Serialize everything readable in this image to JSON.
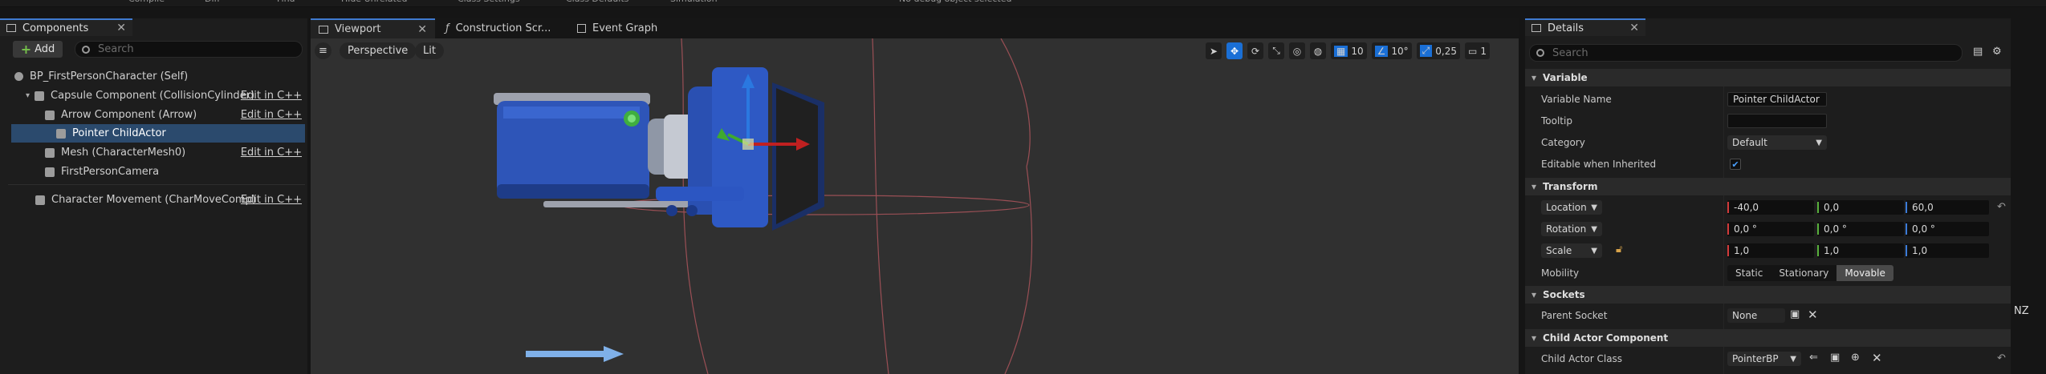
{
  "toolbar": {
    "items": [
      "Compile",
      "Diff",
      "Find",
      "Hide Unrelated",
      "Class Settings",
      "Class Defaults",
      "Simulation",
      "No debug object selected"
    ]
  },
  "components_panel": {
    "tab_title": "Components",
    "add_label": "Add",
    "search_placeholder": "Search",
    "tree": [
      {
        "label": "BP_FirstPersonCharacter (Self)",
        "edit": ""
      },
      {
        "label": "Capsule Component (CollisionCylinder)",
        "edit": "Edit in C++"
      },
      {
        "label": "Arrow Component (Arrow)",
        "edit": "Edit in C++"
      },
      {
        "label": "Pointer ChildActor",
        "edit": ""
      },
      {
        "label": "Mesh (CharacterMesh0)",
        "edit": "Edit in C++"
      },
      {
        "label": "FirstPersonCamera",
        "edit": ""
      },
      {
        "label": "Character Movement (CharMoveComp)",
        "edit": "Edit in C++"
      }
    ]
  },
  "viewport": {
    "tabs": [
      "Viewport",
      "Construction Scr...",
      "Event Graph"
    ],
    "view_mode": "Perspective",
    "lighting": "Lit",
    "grid_snap": "10",
    "rotation_snap": "10°",
    "scale_snap": "0,25",
    "camera_speed": "1"
  },
  "details": {
    "tab_title": "Details",
    "search_placeholder": "Search",
    "sections": {
      "variable": "Variable",
      "transform": "Transform",
      "sockets": "Sockets",
      "child_actor": "Child Actor Component"
    },
    "variable_name_label": "Variable Name",
    "variable_name": "Pointer ChildActor",
    "tooltip_label": "Tooltip",
    "category_label": "Category",
    "category": "Default",
    "editable_label": "Editable when Inherited",
    "editable_checked": true,
    "location_label": "Location",
    "location": [
      "-40,0",
      "0,0",
      "60,0"
    ],
    "rotation_label": "Rotation",
    "rotation": [
      "0,0 °",
      "0,0 °",
      "0,0 °"
    ],
    "scale_label": "Scale",
    "scale": [
      "1,0",
      "1,0",
      "1,0"
    ],
    "mobility_label": "Mobility",
    "mobility_options": [
      "Static",
      "Stationary",
      "Movable"
    ],
    "mobility_selected": "Movable",
    "parent_socket_label": "Parent Socket",
    "parent_socket": "None",
    "child_actor_class_label": "Child Actor Class",
    "child_actor_class": "PointerBP"
  },
  "overlay_text": "NZ",
  "colors": {
    "accent": "#3f7ad0",
    "selection": "#2b4a6d",
    "gizmo_x": "#c02020",
    "gizmo_y": "#3faa2f",
    "gizmo_z": "#2a78e0"
  }
}
